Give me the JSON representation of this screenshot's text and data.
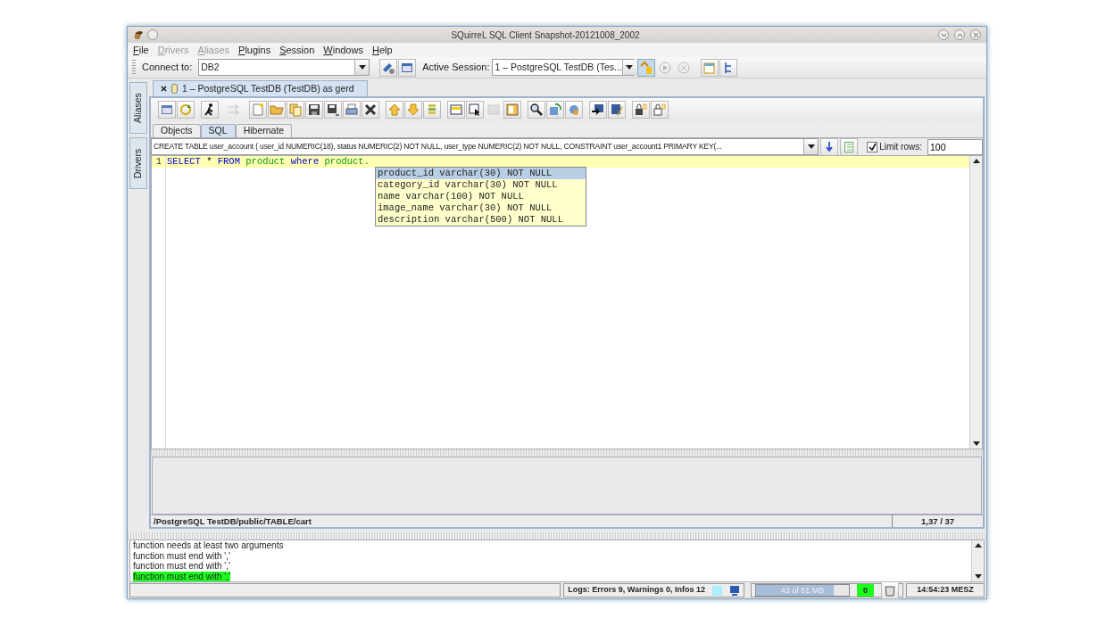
{
  "window": {
    "title": "SQuirreL SQL Client Snapshot-20121008_2002"
  },
  "menu": [
    {
      "label": "File",
      "disabled": false
    },
    {
      "label": "Drivers",
      "disabled": true
    },
    {
      "label": "Aliases",
      "disabled": true
    },
    {
      "label": "Plugins",
      "disabled": false
    },
    {
      "label": "Session",
      "disabled": false
    },
    {
      "label": "Windows",
      "disabled": false
    },
    {
      "label": "Help",
      "disabled": false
    }
  ],
  "connect": {
    "label": "Connect to:",
    "value": "DB2"
  },
  "connect_buttons": [
    {
      "disabled": false,
      "pressed": false
    },
    {
      "disabled": false,
      "pressed": false
    }
  ],
  "session_select": {
    "label": "Active Session:",
    "value": "1 – PostgreSQL TestDB (Tes..."
  },
  "session_buttons": [
    {
      "disabled": false,
      "pressed": true
    },
    {
      "disabled": true,
      "pressed": false
    },
    {
      "disabled": true,
      "pressed": false
    },
    {
      "disabled": false,
      "pressed": false
    },
    {
      "disabled": false,
      "pressed": false
    }
  ],
  "side_tabs": [
    {
      "label": "Aliases"
    },
    {
      "label": "Drivers"
    }
  ],
  "session_tab": {
    "label": "1 – PostgreSQL TestDB (TestDB) as gerd"
  },
  "session_toolbar": [
    [
      {
        "disabled": false
      },
      {
        "disabled": false
      }
    ],
    [
      {
        "disabled": false
      }
    ],
    [
      {
        "disabled": true
      }
    ],
    [
      {
        "disabled": false
      },
      {
        "disabled": false
      },
      {
        "disabled": false
      },
      {
        "disabled": false
      },
      {
        "disabled": false
      },
      {
        "disabled": false
      },
      {
        "disabled": false
      }
    ],
    [
      {
        "disabled": false
      },
      {
        "disabled": false
      },
      {
        "disabled": false
      }
    ],
    [
      {
        "disabled": false
      },
      {
        "disabled": false
      },
      {
        "disabled": true
      },
      {
        "disabled": false
      }
    ],
    [
      {
        "disabled": false
      },
      {
        "disabled": false
      },
      {
        "disabled": false
      }
    ],
    [
      {
        "disabled": false
      },
      {
        "disabled": false
      }
    ],
    [
      {
        "disabled": false
      },
      {
        "disabled": false
      }
    ]
  ],
  "tabs": [
    {
      "label": "Objects",
      "selected": false
    },
    {
      "label": "SQL",
      "selected": true
    },
    {
      "label": "Hibernate",
      "selected": false
    }
  ],
  "history": {
    "value": "CREATE TABLE user_account ( user_id NUMERIC(18), status NUMERIC(2) NOT NULL, user_type NUMERIC(2) NOT NULL, CONSTRAINT user_account1 PRIMARY KEY(..."
  },
  "limit_rows": {
    "label": "Limit rows:",
    "checked": true,
    "value": "100"
  },
  "editor": {
    "lines": [
      {
        "number": "1",
        "current": true,
        "tokens": [
          {
            "text": "SELECT",
            "kind": "keyword"
          },
          {
            "text": "*",
            "kind": "operator"
          },
          {
            "text": "FROM",
            "kind": "keyword"
          },
          {
            "text": "product",
            "kind": "identifier"
          },
          {
            "text": "where",
            "kind": "keyword"
          },
          {
            "text": "product.",
            "kind": "identifier"
          }
        ]
      }
    ]
  },
  "completion": [
    {
      "text": "product_id varchar(30) NOT NULL",
      "selected": true
    },
    {
      "text": "category_id varchar(30) NOT NULL",
      "selected": false
    },
    {
      "text": "name varchar(100) NOT NULL",
      "selected": false
    },
    {
      "text": "image_name varchar(30) NOT NULL",
      "selected": false
    },
    {
      "text": "description varchar(500) NOT NULL",
      "selected": false
    }
  ],
  "object_path": "/PostgreSQL TestDB/public/TABLE/cart",
  "caret_position": "1,37 / 37",
  "log_messages": [
    {
      "text": "function needs at least two arguments",
      "highlighted": false
    },
    {
      "text": "function must end with ','",
      "highlighted": false
    },
    {
      "text": "function must end with ','",
      "highlighted": false
    },
    {
      "text": "function must end with ','",
      "highlighted": true
    }
  ],
  "status": {
    "logs": "Logs: Errors 9, Warnings 0, Infos 12",
    "memory": {
      "text": "43 of 51 MB",
      "level": 0.84
    },
    "threads": "0",
    "clock": "14:54:23 MESZ"
  }
}
